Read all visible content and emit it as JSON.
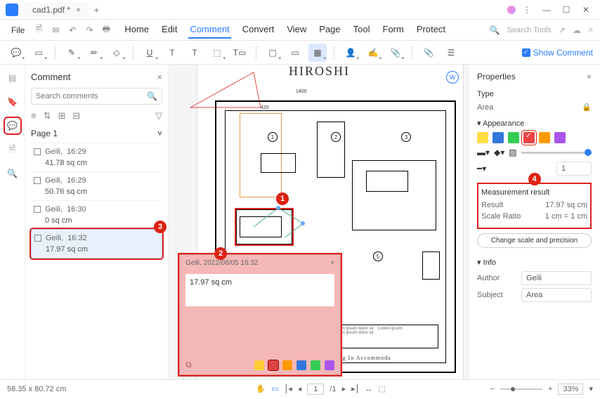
{
  "titlebar": {
    "filename": "cad1.pdf *"
  },
  "menu": {
    "file": "File",
    "home": "Home",
    "edit": "Edit",
    "comment": "Comment",
    "convert": "Convert",
    "view": "View",
    "page": "Page",
    "tool": "Tool",
    "form": "Form",
    "protect": "Protect",
    "search": "Search Tools"
  },
  "toolbar": {
    "showcomment": "Show Comment"
  },
  "panel": {
    "title": "Comment",
    "search_ph": "Search comments",
    "page": "Page 1",
    "items": [
      {
        "author": "Geili,",
        "time": "16:29",
        "value": "41.78 sq cm"
      },
      {
        "author": "Geili,",
        "time": "16:29",
        "value": "50.76 sq cm"
      },
      {
        "author": "Geili,",
        "time": "16:30",
        "value": "0 sq cm"
      },
      {
        "author": "Geili,",
        "time": "16:32",
        "value": "17.97 sq cm"
      }
    ]
  },
  "doc": {
    "title": "HIROSHI",
    "dim_top": "1400",
    "dim_mid": "420",
    "footer": "Spa / Living In Accommoda"
  },
  "popup": {
    "meta": "Geili,  2022/08/05 16:32",
    "value": "17.97 sq cm"
  },
  "props": {
    "title": "Properties",
    "type_l": "Type",
    "type_v": "Area",
    "appearance": "Appearance",
    "mres_t": "Measurement result",
    "result_l": "Result",
    "result_v": "17.97 sq cm",
    "scale_l": "Scale Ratio",
    "scale_v": "1 cm = 1 cm",
    "change": "Change scale and precision",
    "info": "Info",
    "author_l": "Author",
    "author_v": "Geili",
    "subject_l": "Subject",
    "subject_v": "Area",
    "thick": "1"
  },
  "bubbles": {
    "1": "1",
    "2": "2",
    "3": "3",
    "4": "4"
  },
  "status": {
    "coords": "58.35 x 80.72 cm",
    "page_cur": "1",
    "page_tot": "/1",
    "zoom": "33%"
  }
}
